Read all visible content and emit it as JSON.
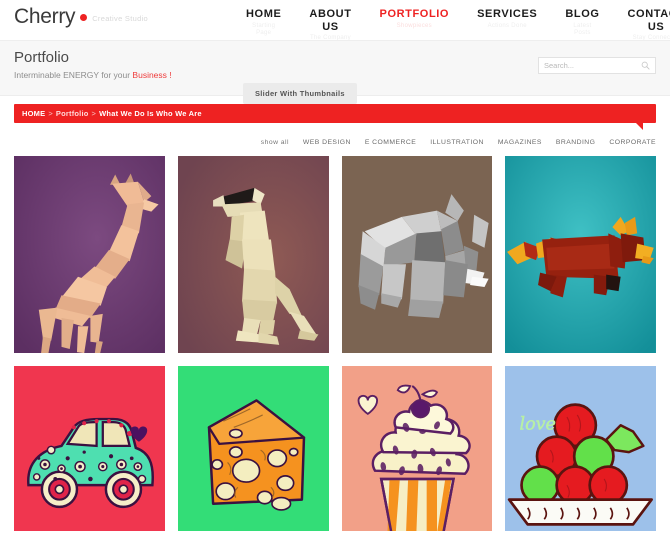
{
  "brand": {
    "name": "Cherry",
    "tagline": "Creative Studio",
    "dot_color": "#ee2222"
  },
  "nav": {
    "items": [
      {
        "label": "HOME",
        "sub": "Starting Page",
        "active": false
      },
      {
        "label": "ABOUT US",
        "sub": "The Company",
        "active": false
      },
      {
        "label": "PORTFOLIO",
        "sub": "Showpieces",
        "active": true
      },
      {
        "label": "SERVICES",
        "sub": "Actions Done",
        "active": false
      },
      {
        "label": "BLOG",
        "sub": "Latest Posts",
        "active": false
      },
      {
        "label": "CONTACT US",
        "sub": "Stay Connected",
        "active": false
      }
    ]
  },
  "page": {
    "title": "Portfolio",
    "subtitle_prefix": "Interminable ENERGY for your ",
    "subtitle_highlight": "Business !",
    "slider_chip": "Slider With Thumbnails"
  },
  "search": {
    "placeholder": "Search...",
    "value": "",
    "icon": "search-icon"
  },
  "breadcrumb": {
    "home": "HOME",
    "sep1": ">",
    "section": "Portfolio",
    "sep2": ">",
    "current": "What We Do Is Who We Are",
    "bar_color": "#ee2222"
  },
  "filters": [
    {
      "label": "show all",
      "active": true
    },
    {
      "label": "WEB DESIGN",
      "active": false
    },
    {
      "label": "E COMMERCE",
      "active": false
    },
    {
      "label": "ILLUSTRATION",
      "active": false
    },
    {
      "label": "MAGAZINES",
      "active": false
    },
    {
      "label": "BRANDING",
      "active": false
    },
    {
      "label": "CORPORATE",
      "active": false
    }
  ],
  "portfolio": {
    "items": [
      {
        "id": "giraffe",
        "alt": "Low-poly giraffe illustration",
        "bg": "#6b3a70",
        "row": 1
      },
      {
        "id": "meerkat",
        "alt": "Low-poly meerkat illustration",
        "bg": "#7d4a55",
        "row": 1
      },
      {
        "id": "elephant",
        "alt": "Low-poly elephant illustration",
        "bg": "#7b6452",
        "row": 1
      },
      {
        "id": "redpanda",
        "alt": "Low-poly red panda illustration",
        "bg": "#1fa0a8",
        "row": 1
      },
      {
        "id": "car",
        "alt": "Polka dot car illustration",
        "bg": "#f0364f",
        "row": 2
      },
      {
        "id": "cheese",
        "alt": "Cheese wedge illustration",
        "bg": "#33dd77",
        "row": 2
      },
      {
        "id": "cupcake",
        "alt": "Cupcake illustration",
        "bg": "#f2a088",
        "row": 2
      },
      {
        "id": "apples",
        "alt": "Bowl of apples illustration with love text",
        "bg": "#9dc1ea",
        "row": 2,
        "caption": "love"
      }
    ]
  }
}
